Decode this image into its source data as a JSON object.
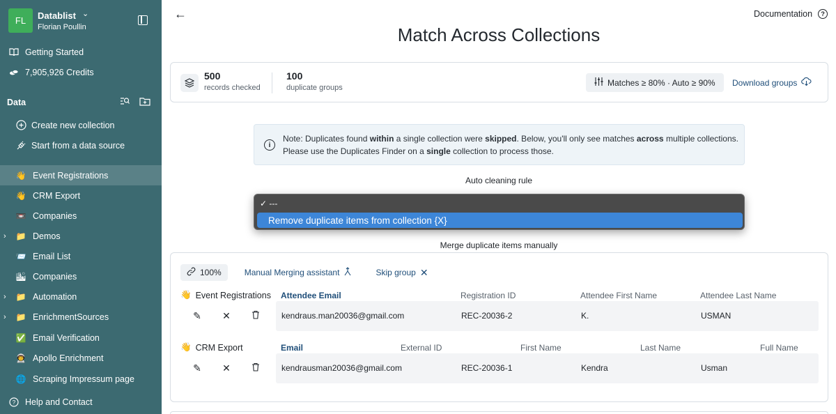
{
  "workspace": {
    "initials": "FL",
    "name": "Datablist",
    "user": "Florian Poullin"
  },
  "sidebar": {
    "top_items": [
      {
        "label": "Getting Started",
        "icon": "book-icon"
      },
      {
        "label": "7,905,926 Credits",
        "icon": "coins-icon"
      }
    ],
    "data_header": "Data",
    "actions": [
      {
        "label": "Create new collection",
        "icon": "plus-circle-icon"
      },
      {
        "label": "Start from a data source",
        "icon": "plug-icon"
      }
    ],
    "collections": [
      {
        "label": "Event Registrations",
        "icon": "👋",
        "active": true,
        "folder": false
      },
      {
        "label": "CRM Export",
        "icon": "👋",
        "active": false,
        "folder": false
      },
      {
        "label": "Companies",
        "icon": "📼",
        "active": false,
        "folder": false
      },
      {
        "label": "Demos",
        "icon": "📁",
        "active": false,
        "folder": true
      },
      {
        "label": "Email List",
        "icon": "📨",
        "active": false,
        "folder": false
      },
      {
        "label": "Companies",
        "icon": "🏙",
        "active": false,
        "folder": false
      },
      {
        "label": "Automation",
        "icon": "📁",
        "active": false,
        "folder": true
      },
      {
        "label": "EnrichmentSources",
        "icon": "📁",
        "active": false,
        "folder": true
      },
      {
        "label": "Email Verification",
        "icon": "✅",
        "active": false,
        "folder": false
      },
      {
        "label": "Apollo Enrichment",
        "icon": "👨‍🚀",
        "active": false,
        "folder": false
      },
      {
        "label": "Scraping Impressum page",
        "icon": "🌐",
        "active": false,
        "folder": false
      }
    ],
    "footer": {
      "label": "Help and Contact",
      "icon": "help-circle-icon"
    }
  },
  "header": {
    "back": "←",
    "documentation": "Documentation",
    "title": "Match Across Collections"
  },
  "stats": {
    "records_value": "500",
    "records_label": "records checked",
    "groups_value": "100",
    "groups_label": "duplicate groups",
    "match_button": "Matches ≥ 80% · Auto ≥ 90%",
    "download_button": "Download groups"
  },
  "note": {
    "p1": "Note: Duplicates found ",
    "b1": "within",
    "p2": " a single collection were ",
    "b2": "skipped",
    "p3": ". Below, you'll only see matches ",
    "b3": "across",
    "p4": " multiple collections.",
    "p5": "Please use the Duplicates Finder on a ",
    "b4": "single",
    "p6": " collection to process those."
  },
  "auto_cleaning": {
    "label": "Auto cleaning rule",
    "options": [
      "✓ ---",
      "Remove duplicate items from collection {X}"
    ]
  },
  "merge_label": "Merge duplicate items manually",
  "group": {
    "similarity": "100%",
    "assistant": "Manual Merging assistant",
    "skip": "Skip group",
    "records": [
      {
        "collection": "Event Registrations",
        "emoji": "👋",
        "headers": [
          "Attendee Email",
          "Registration ID",
          "Attendee First Name",
          "Attendee Last Name"
        ],
        "values": [
          "kendraus.man20036@gmail.com",
          "REC-20036-2",
          "K.",
          "USMAN"
        ]
      },
      {
        "collection": "CRM Export",
        "emoji": "👋",
        "headers": [
          "Email",
          "External ID",
          "First Name",
          "Last Name",
          "Full Name"
        ],
        "values": [
          "kendrausman20036@gmail.com",
          "REC-20036-1",
          "Kendra",
          "Usman"
        ]
      }
    ]
  }
}
